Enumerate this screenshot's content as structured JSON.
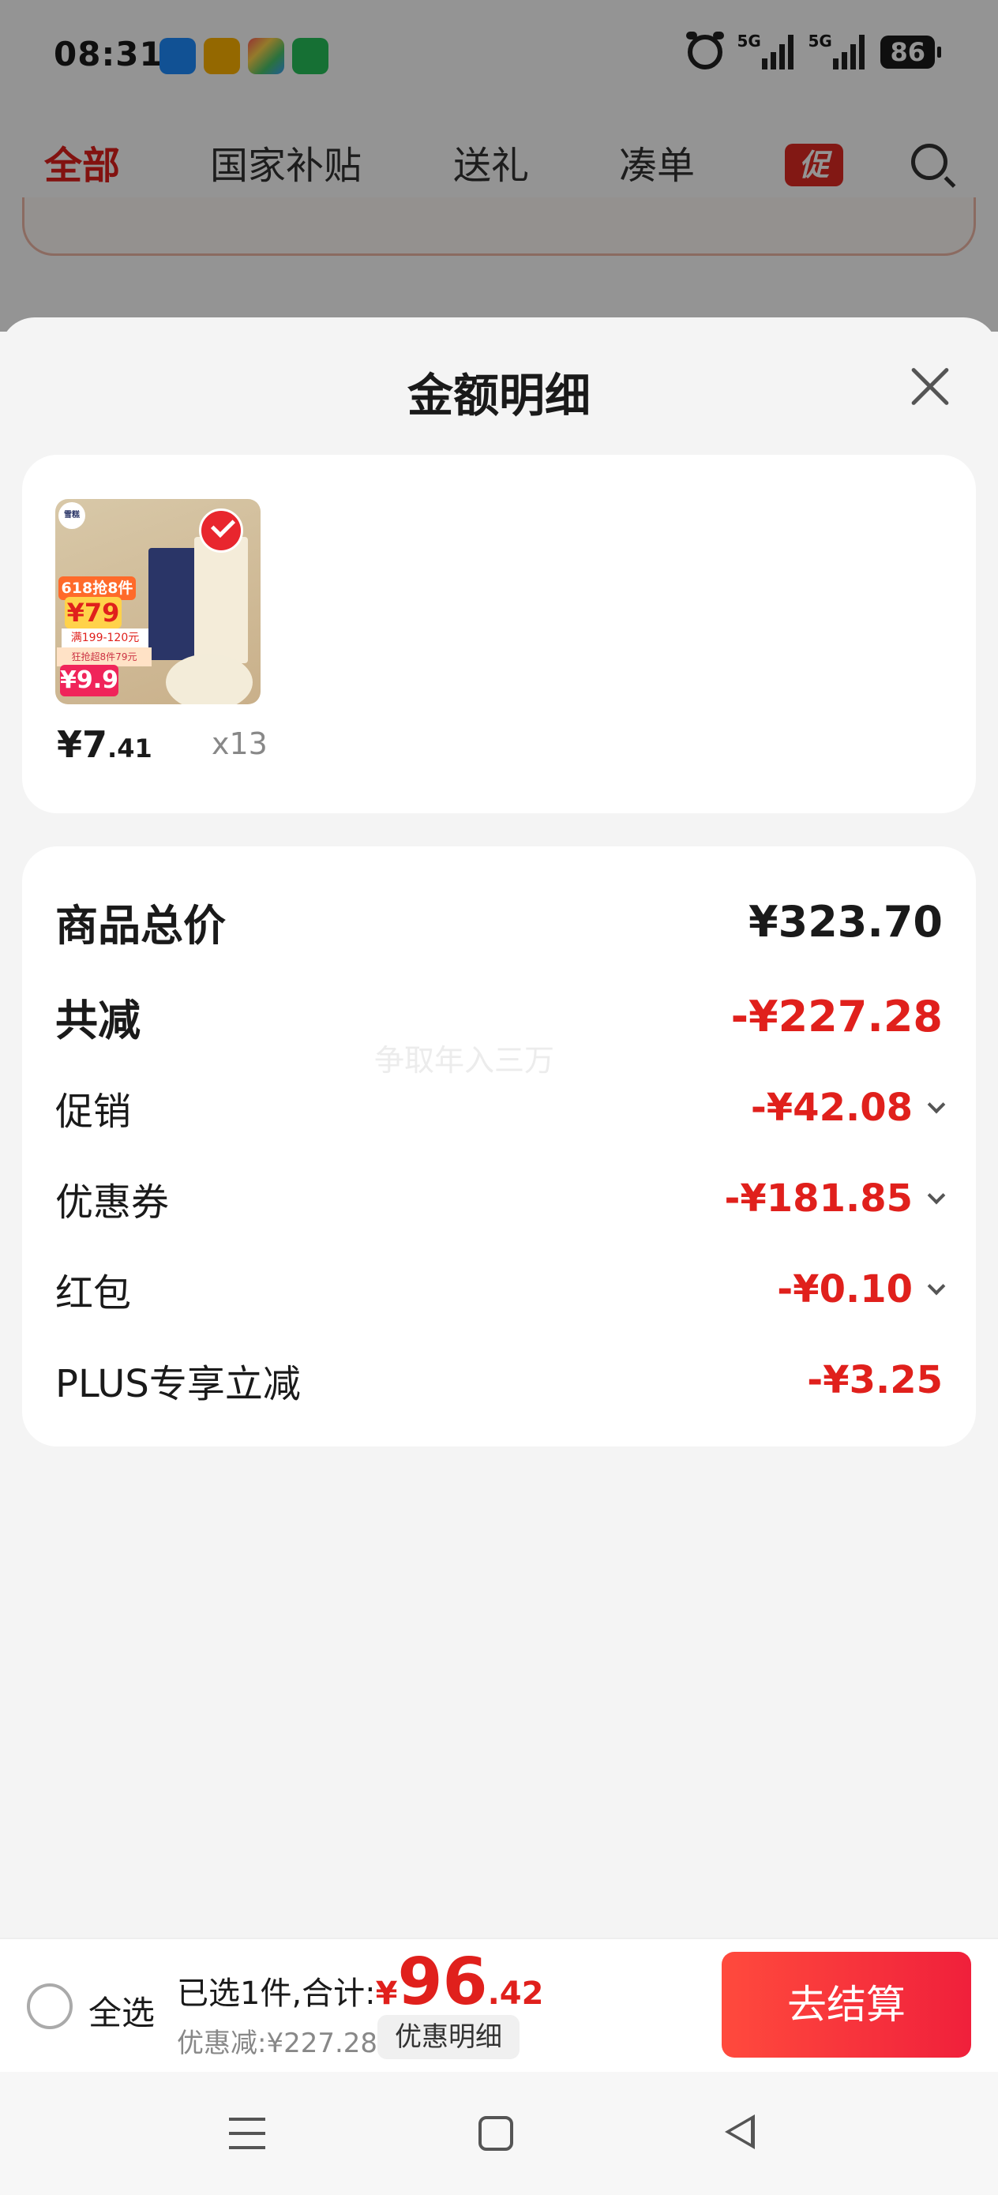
{
  "status_bar": {
    "time": "08:31",
    "apps": [
      "navigation-app-icon",
      "weibo-icon",
      "multicolor-app-icon",
      "chat-app-icon"
    ],
    "network_1": "5G",
    "network_2": "5G",
    "battery": "86"
  },
  "top_tabs": [
    {
      "label": "全部",
      "active": true
    },
    {
      "label": "国家补贴",
      "active": false
    },
    {
      "label": "送礼",
      "active": false
    },
    {
      "label": "凑单",
      "active": false
    }
  ],
  "promo_tag": "促",
  "sheet": {
    "title": "金额明细",
    "product": {
      "thumbnail_texts": {
        "tag_top": "618抢8件",
        "price_top": "¥79",
        "sub": "满199-120元",
        "tag_bottom": "狂抢超8件79元",
        "price_bottom": "¥9.9",
        "logo": "雪糕"
      },
      "price_symbol": "¥",
      "price_int": "7",
      "price_dec": ".41",
      "quantity": "x13"
    },
    "breakdown": {
      "total": {
        "label": "商品总价",
        "value": "¥323.70"
      },
      "reduction": {
        "label": "共减",
        "value": "-¥227.28"
      },
      "items": [
        {
          "label": "促销",
          "value": "-¥42.08",
          "expandable": true
        },
        {
          "label": "优惠券",
          "value": "-¥181.85",
          "expandable": true
        },
        {
          "label": "红包",
          "value": "-¥0.10",
          "expandable": true
        },
        {
          "label": "PLUS专享立减",
          "value": "-¥3.25",
          "expandable": false
        }
      ]
    },
    "watermark": "争取年入三万"
  },
  "checkout_bar": {
    "select_all": "全选",
    "summary_label": "已选1件,合计:",
    "currency": "¥",
    "total_int": "96",
    "total_dec": ".42",
    "discount_text": "优惠减:¥227.28",
    "discount_detail_button": "优惠明细",
    "checkout_button": "去结算"
  },
  "colors": {
    "accent_red": "#e0201c",
    "checkout_gradient_start": "#ff4a3d",
    "checkout_gradient_end": "#f0203b"
  }
}
